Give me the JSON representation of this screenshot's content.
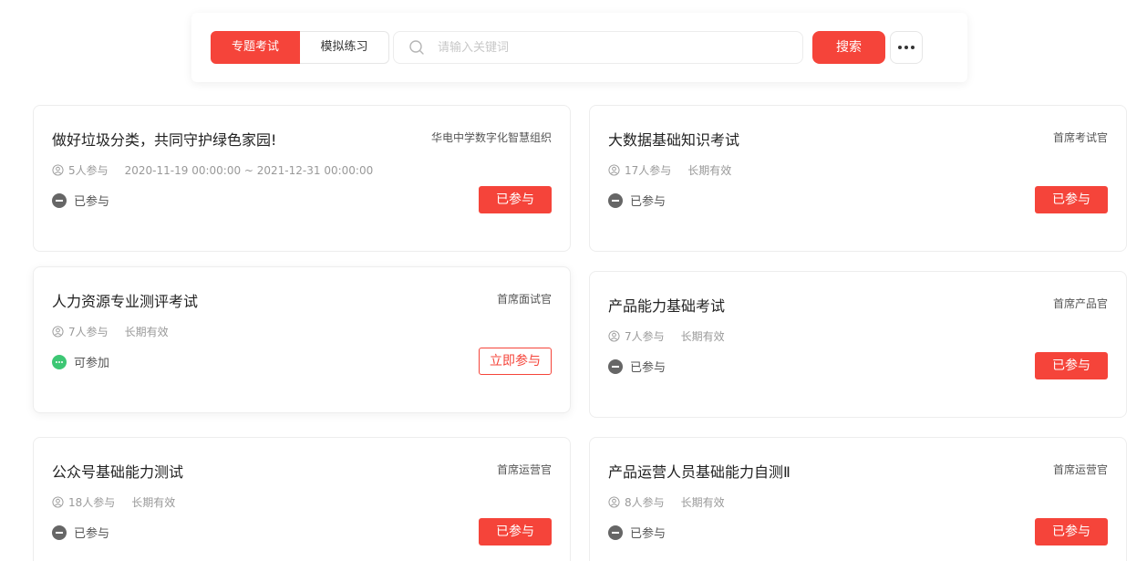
{
  "tabs": [
    {
      "label": "专题考试",
      "active": true
    },
    {
      "label": "模拟练习",
      "active": false
    }
  ],
  "search": {
    "placeholder": "请输入关键词",
    "button_label": "搜索",
    "icon": "search-icon"
  },
  "more": {
    "icon": "more-dots-icon"
  },
  "colors": {
    "accent": "#f5443a",
    "joined_dot": "#666666",
    "available_dot": "#3dc774"
  },
  "cards": [
    {
      "title": "做好垃圾分类，共同守护绿色家园!",
      "org": "华电中学数字化智慧组织",
      "participants": "5人参与",
      "period": "2020-11-19 00:00:00 ~ 2021-12-31 00:00:00",
      "status": "已参与",
      "status_type": "joined",
      "button": "已参与"
    },
    {
      "title": "大数据基础知识考试",
      "org": "首席考试官",
      "participants": "17人参与",
      "period": "长期有效",
      "status": "已参与",
      "status_type": "joined",
      "button": "已参与"
    },
    {
      "title": "人力资源专业测评考试",
      "org": "首席面试官",
      "participants": "7人参与",
      "period": "长期有效",
      "status": "可参加",
      "status_type": "available",
      "button": "立即参与"
    },
    {
      "title": "产品能力基础考试",
      "org": "首席产品官",
      "participants": "7人参与",
      "period": "长期有效",
      "status": "已参与",
      "status_type": "joined",
      "button": "已参与"
    },
    {
      "title": "公众号基础能力测试",
      "org": "首席运营官",
      "participants": "18人参与",
      "period": "长期有效",
      "status": "已参与",
      "status_type": "joined",
      "button": "已参与"
    },
    {
      "title": "产品运营人员基础能力自测Ⅱ",
      "org": "首席运营官",
      "participants": "8人参与",
      "period": "长期有效",
      "status": "已参与",
      "status_type": "joined",
      "button": "已参与"
    }
  ]
}
